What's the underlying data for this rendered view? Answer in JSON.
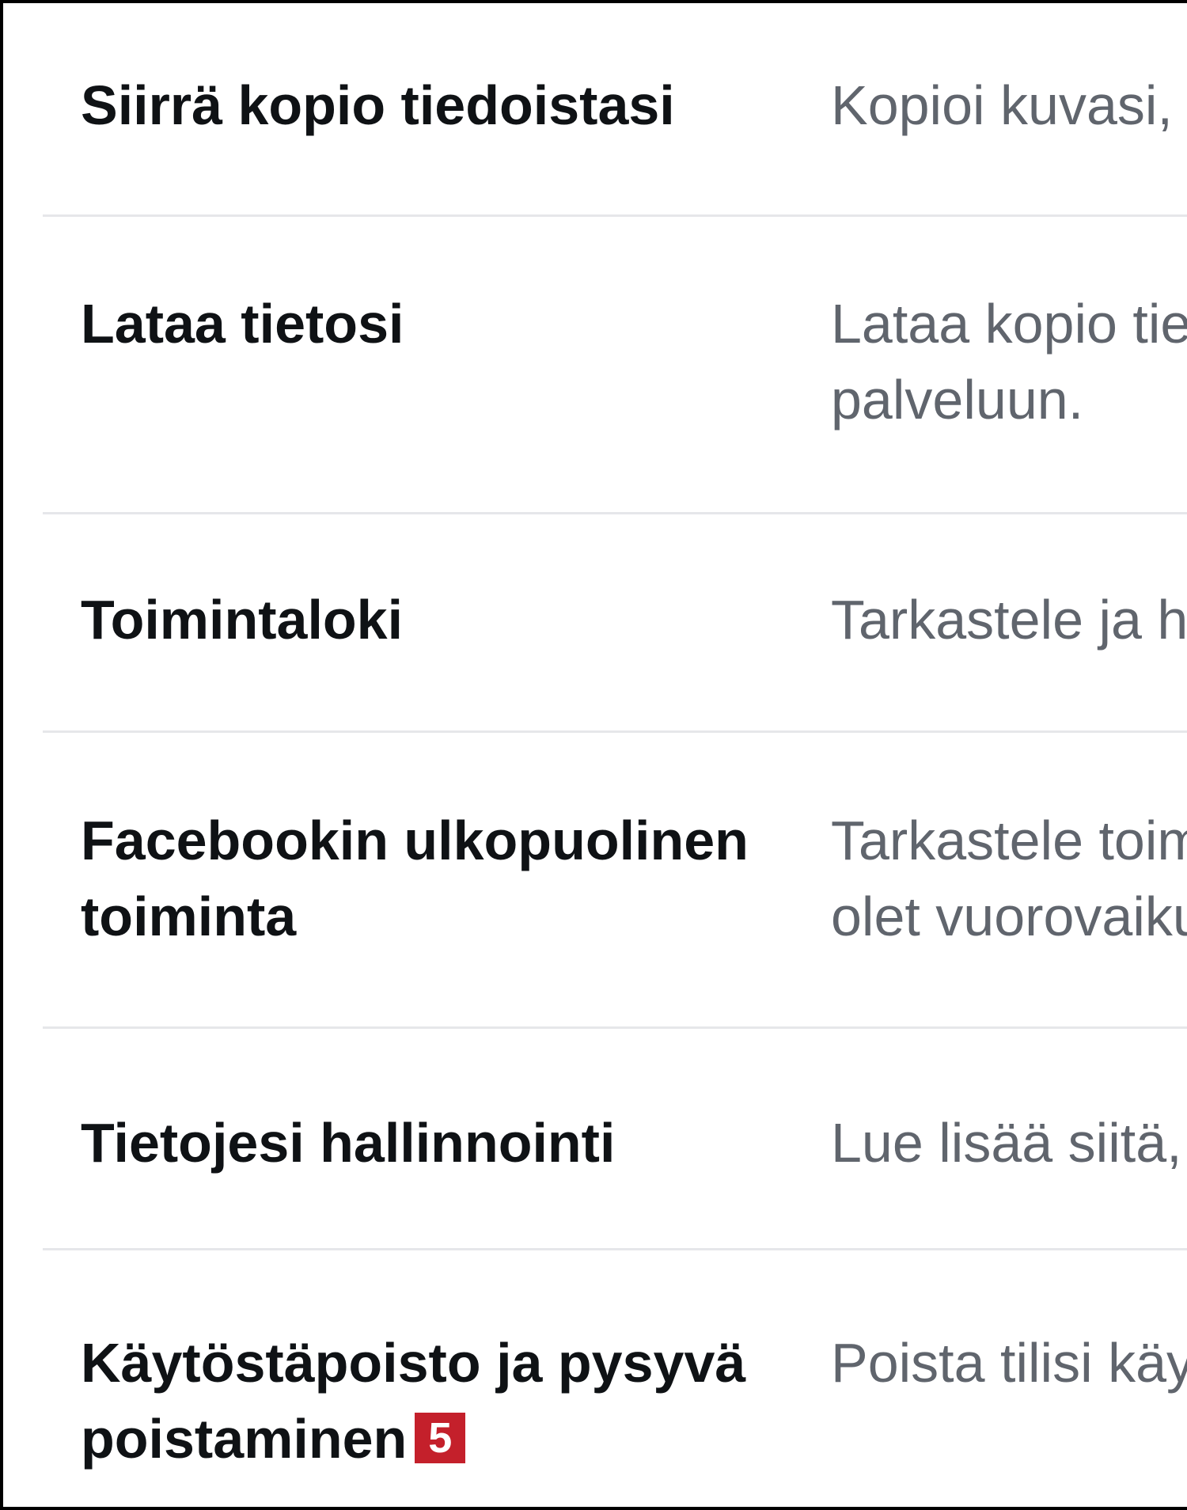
{
  "settings": {
    "rows": [
      {
        "title": "Siirrä kopio tiedoistasi",
        "description": "Kopioi kuvasi,"
      },
      {
        "title": "Lataa tietosi",
        "description_lines": [
          "Lataa kopio tie",
          "palveluun."
        ]
      },
      {
        "title": "Toimintaloki",
        "description": "Tarkastele ja h"
      },
      {
        "title_lines": [
          "Facebookin ulkopuolinen",
          "toiminta"
        ],
        "description_lines": [
          "Tarkastele toim",
          "olet vuorovaiku"
        ]
      },
      {
        "title": "Tietojesi hallinnointi",
        "description": "Lue lisää siitä,"
      },
      {
        "title_lines": [
          "Käytöstäpoisto ja pysyvä",
          "poistaminen"
        ],
        "badge": "5",
        "description": "Poista tilisi käy"
      }
    ],
    "colors": {
      "title": "#0f1215",
      "description": "#60656d",
      "divider": "#e6e7ea",
      "badge": "#c4202b"
    }
  }
}
